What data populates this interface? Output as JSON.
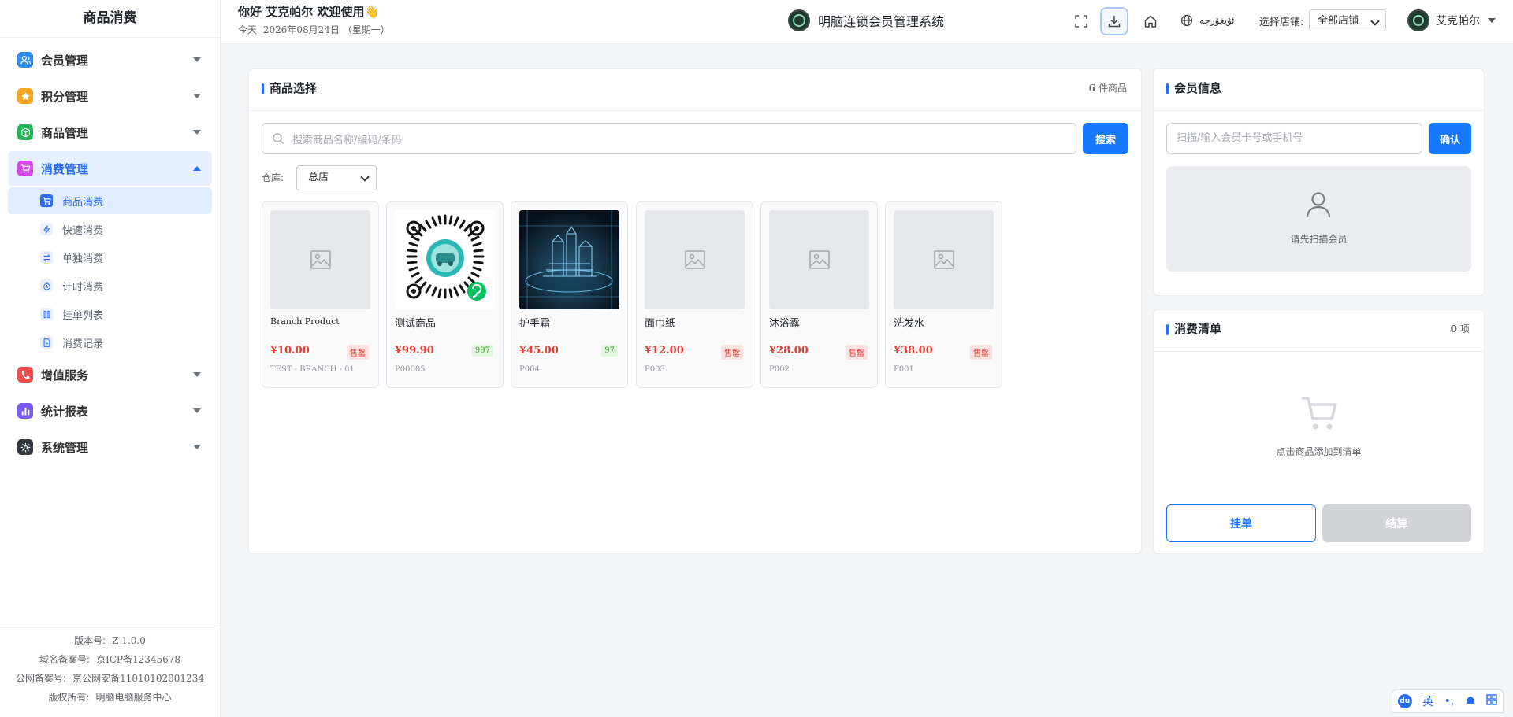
{
  "sidebar": {
    "title": "商品消费",
    "menus": [
      {
        "label": "会员管理",
        "icon": "users-icon",
        "color": "#2d8cf0"
      },
      {
        "label": "积分管理",
        "icon": "star-icon",
        "color": "#f5a623"
      },
      {
        "label": "商品管理",
        "icon": "box-icon",
        "color": "#23b15a"
      },
      {
        "label": "消费管理",
        "icon": "cart-icon",
        "color": "#d946ef"
      },
      {
        "label": "增值服务",
        "icon": "phone-icon",
        "color": "#f04b4b"
      },
      {
        "label": "统计报表",
        "icon": "bar-chart-icon",
        "color": "#7c5cf0"
      },
      {
        "label": "系统管理",
        "icon": "gear-icon",
        "color": "#333842"
      }
    ],
    "submenu": [
      {
        "label": "商品消费",
        "icon": "cart-icon"
      },
      {
        "label": "快速消费",
        "icon": "bolt-icon"
      },
      {
        "label": "单独消费",
        "icon": "swap-icon"
      },
      {
        "label": "计时消费",
        "icon": "timer-icon"
      },
      {
        "label": "挂单列表",
        "icon": "columns-icon"
      },
      {
        "label": "消费记录",
        "icon": "document-icon"
      }
    ],
    "footer": {
      "version_label": "版本号:",
      "version": "Z 1.0.0",
      "domain_label": "域名备案号:",
      "domain": "京ICP备12345678",
      "police_label": "公网备案号:",
      "police": "京公网安备11010102001234",
      "copyright_label": "版权所有:",
      "copyright": "明脑电脑服务中心"
    }
  },
  "header": {
    "greeting": "你好  艾克帕尔  欢迎使用👋",
    "today_label": "今天",
    "date": "2026年08月24日",
    "weekday": "（星期一）",
    "system_name": "明脑连锁会员管理系统",
    "language": "ئۇيغۇرچە",
    "store_label": "选择店铺:",
    "store_value": "全部店铺",
    "user_name": "艾克帕尔"
  },
  "products_card": {
    "title": "商品选择",
    "count": "6",
    "count_unit": "件商品",
    "search_placeholder": "搜索商品名称/编码/条码",
    "search_button": "搜索",
    "warehouse_label": "仓库:",
    "warehouse_value": "总店",
    "items": [
      {
        "name": "Branch Product",
        "price": "¥10.00",
        "badge": "售罄",
        "badge_type": "sold",
        "code": "TEST - BRANCH - 01",
        "image": "placeholder"
      },
      {
        "name": "测试商品",
        "price": "¥99.90",
        "badge": "997",
        "badge_type": "stock",
        "code": "P00005",
        "image": "qr"
      },
      {
        "name": "护手霜",
        "price": "¥45.00",
        "badge": "97",
        "badge_type": "stock",
        "code": "P004",
        "image": "photo"
      },
      {
        "name": "面巾纸",
        "price": "¥12.00",
        "badge": "售罄",
        "badge_type": "sold",
        "code": "P003",
        "image": "placeholder"
      },
      {
        "name": "沐浴露",
        "price": "¥28.00",
        "badge": "售罄",
        "badge_type": "sold",
        "code": "P002",
        "image": "placeholder"
      },
      {
        "name": "洗发水",
        "price": "¥38.00",
        "badge": "售罄",
        "badge_type": "sold",
        "code": "P001",
        "image": "placeholder"
      }
    ]
  },
  "member_card": {
    "title": "会员信息",
    "input_placeholder": "扫描/输入会员卡号或手机号",
    "confirm_button": "确认",
    "empty_text": "请先扫描会员"
  },
  "bill_card": {
    "title": "消费清单",
    "count": "0",
    "count_unit": "项",
    "empty_text": "点击商品添加到清单",
    "hang_button": "挂单",
    "settle_button": "结算"
  },
  "ime_bar": {
    "mode": "英"
  },
  "colors": {
    "accent": "#1677ff",
    "price": "#e43d33"
  }
}
